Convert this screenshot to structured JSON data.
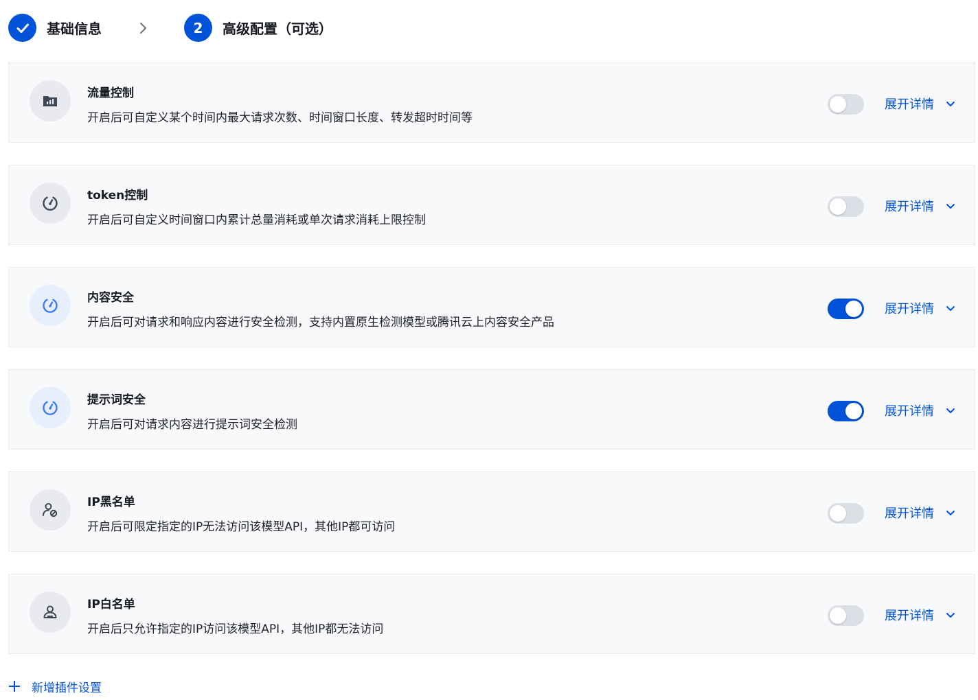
{
  "steps": [
    {
      "label": "基础信息",
      "state": "done"
    },
    {
      "number": "2",
      "label": "高级配置（可选）",
      "state": "current"
    }
  ],
  "accent": "#0052d9",
  "plugins": [
    {
      "title": "流量控制",
      "desc": "开启后可自定义某个时间内最大请求次数、时间窗口长度、转发超时时间等",
      "enabled": false,
      "icon": "chart-folder-icon",
      "expand_label": "展开详情"
    },
    {
      "title": "token控制",
      "desc": "开启后可自定义时间窗口内累计总量消耗或单次请求消耗上限控制",
      "enabled": false,
      "icon": "gauge-icon",
      "expand_label": "展开详情"
    },
    {
      "title": "内容安全",
      "desc": "开启后可对请求和响应内容进行安全检测，支持内置原生检测模型或腾讯云上内容安全产品",
      "enabled": true,
      "icon": "gauge-icon",
      "expand_label": "展开详情"
    },
    {
      "title": "提示词安全",
      "desc": "开启后可对请求内容进行提示词安全检测",
      "enabled": true,
      "icon": "gauge-icon",
      "expand_label": "展开详情"
    },
    {
      "title": "IP黑名单",
      "desc": "开启后可限定指定的IP无法访问该模型API，其他IP都可访问",
      "enabled": false,
      "icon": "user-block-icon",
      "expand_label": "展开详情"
    },
    {
      "title": "IP白名单",
      "desc": "开启后只允许指定的IP访问该模型API，其他IP都无法访问",
      "enabled": false,
      "icon": "user-icon",
      "expand_label": "展开详情"
    }
  ],
  "add_plugin_label": "新增插件设置"
}
